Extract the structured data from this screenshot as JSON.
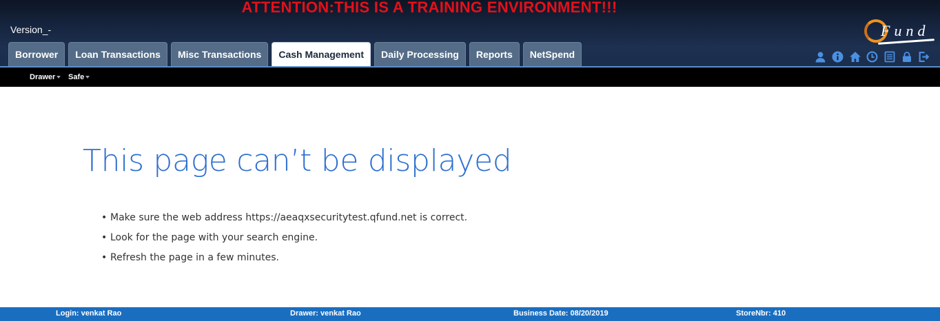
{
  "banner": "ATTENTION:THIS IS A TRAINING ENVIRONMENT!!!",
  "version": "Version_-",
  "logo": {
    "text": "Fund",
    "brand_color": "#f0921f"
  },
  "tabs": [
    {
      "label": "Borrower",
      "active": false
    },
    {
      "label": "Loan Transactions",
      "active": false
    },
    {
      "label": "Misc Transactions",
      "active": false
    },
    {
      "label": "Cash Management",
      "active": true
    },
    {
      "label": "Daily Processing",
      "active": false
    },
    {
      "label": "Reports",
      "active": false
    },
    {
      "label": "NetSpend",
      "active": false
    }
  ],
  "toolbar_icons": [
    "user-icon",
    "info-icon",
    "home-icon",
    "clock-icon",
    "notes-icon",
    "lock-icon",
    "logout-icon"
  ],
  "subnav": {
    "drawer_label": "Drawer",
    "safe_label": "Safe"
  },
  "error": {
    "title": "This page can’t be displayed",
    "tips": [
      "Make sure the web address https://aeaqxsecuritytest.qfund.net is correct.",
      "Look for the page with your search engine.",
      "Refresh the page in a few minutes."
    ]
  },
  "footer": {
    "login": "Login: venkat Rao",
    "drawer": "Drawer: venkat Rao",
    "business_date": "Business Date: 08/20/2019",
    "store_nbr": "StoreNbr: 410"
  },
  "colors": {
    "banner": "#e4101a",
    "header_bg": "#1b2d4c",
    "tab": "#546c87",
    "accent_blue": "#2d6fd0",
    "footer": "#1a6ec0",
    "icon": "#4a90e2"
  }
}
